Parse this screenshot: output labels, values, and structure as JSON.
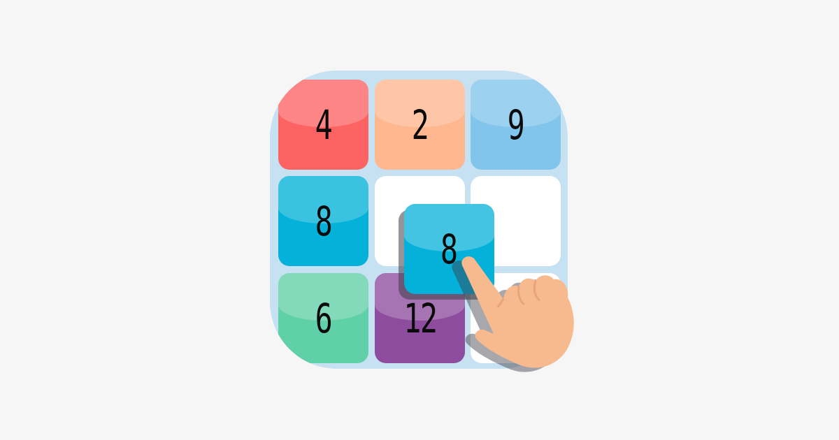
{
  "board": {
    "tiles": [
      {
        "value": "4",
        "color": "#fe6363"
      },
      {
        "value": "2",
        "color": "#feb78e"
      },
      {
        "value": "9",
        "color": "#81c4ec"
      },
      {
        "value": "8",
        "color": "#03b1d9"
      },
      {
        "value": "",
        "color": "#ffffff"
      },
      {
        "value": "",
        "color": "#ffffff"
      },
      {
        "value": "6",
        "color": "#60d0a8"
      },
      {
        "value": "12",
        "color": "#8e4c9e"
      },
      {
        "value": "",
        "color": "#ffffff"
      }
    ],
    "background_color": "#c6e1f1"
  },
  "dragged_tile": {
    "value": "8",
    "color": "#03b1d9"
  },
  "icons": {
    "pointer": "pointing-hand-icon"
  }
}
